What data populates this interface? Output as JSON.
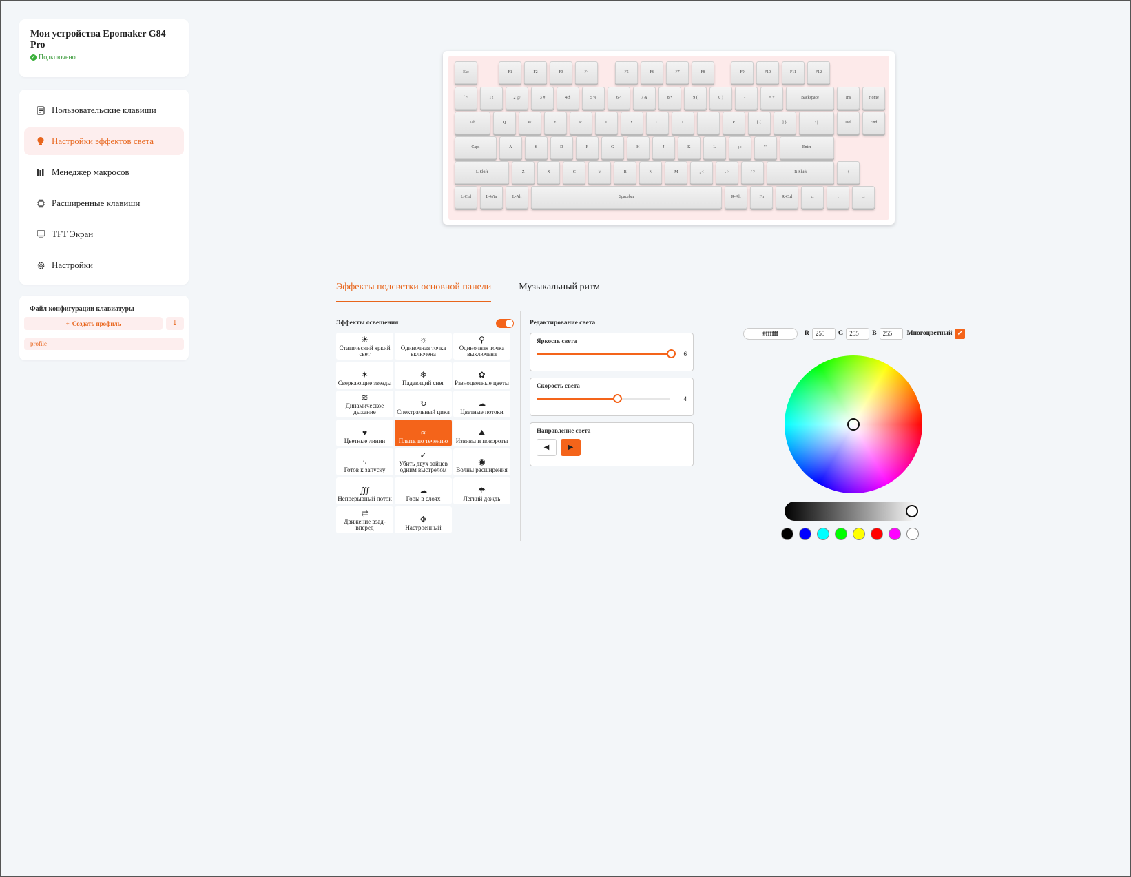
{
  "device": {
    "title": "Мои устройства Epomaker G84 Pro",
    "status": "Подключено"
  },
  "nav": {
    "items": [
      {
        "label": "Пользовательские клавиши",
        "icon": "custom-keys-icon"
      },
      {
        "label": "Настройки эффектов света",
        "icon": "light-bulb-icon"
      },
      {
        "label": "Менеджер макросов",
        "icon": "macro-icon"
      },
      {
        "label": "Расширенные клавиши",
        "icon": "chip-icon"
      },
      {
        "label": "TFT Экран",
        "icon": "monitor-icon"
      },
      {
        "label": "Настройки",
        "icon": "gear-icon"
      }
    ],
    "active_index": 1
  },
  "profile": {
    "label": "Файл конфигурации клавиатуры",
    "create_label": "Создать профиль",
    "items": [
      "profile"
    ]
  },
  "keyboard": {
    "rows": [
      [
        "Esc",
        "F1",
        "F2",
        "F3",
        "F4",
        "F5",
        "F6",
        "F7",
        "F8",
        "F9",
        "F10",
        "F11",
        "F12"
      ],
      [
        "` ~",
        "1 !",
        "2 @",
        "3 #",
        "4 $",
        "5 %",
        "6 ^",
        "7 &",
        "8 *",
        "9 (",
        "0 )",
        "- _",
        "= +",
        "Backspace",
        "Ins",
        "Home"
      ],
      [
        "Tab",
        "Q",
        "W",
        "E",
        "R",
        "T",
        "Y",
        "U",
        "I",
        "O",
        "P",
        "[ {",
        "] }",
        "\\ |",
        "Del",
        "End"
      ],
      [
        "Caps",
        "A",
        "S",
        "D",
        "F",
        "G",
        "H",
        "J",
        "K",
        "L",
        "; :",
        "' \"",
        "Enter"
      ],
      [
        "L-Shift",
        "Z",
        "X",
        "C",
        "V",
        "B",
        "N",
        "M",
        ", <",
        ". >",
        "/ ?",
        "R-Shift",
        "↑"
      ],
      [
        "L-Ctrl",
        "L-Win",
        "L-Alt",
        "Spacebar",
        "R-Alt",
        "Fn",
        "R-Ctrl",
        "←",
        "↓",
        "→"
      ]
    ]
  },
  "tabs": [
    {
      "label": "Эффекты подсветки основной панели",
      "active": true
    },
    {
      "label": "Музыкальный ритм",
      "active": false
    }
  ],
  "effects": {
    "title": "Эффекты освещения",
    "enabled": true,
    "items": [
      {
        "label": "Статический яркий свет",
        "icon": "sun-icon"
      },
      {
        "label": "Одиночная точка включена",
        "icon": "sun-outline-icon"
      },
      {
        "label": "Одиночная точка выключена",
        "icon": "bulb-icon"
      },
      {
        "label": "Сверкающие звезды",
        "icon": "stars-icon"
      },
      {
        "label": "Падающий снег",
        "icon": "snow-icon"
      },
      {
        "label": "Разноцветные цветы",
        "icon": "flower-icon"
      },
      {
        "label": "Динамическое дыхание",
        "icon": "wind-icon"
      },
      {
        "label": "Спектральный цикл",
        "icon": "cycle-icon"
      },
      {
        "label": "Цветные потоки",
        "icon": "flow-icon"
      },
      {
        "label": "Цветные линии",
        "icon": "lines-icon"
      },
      {
        "label": "Плыть по течению",
        "icon": "waves-icon"
      },
      {
        "label": "Извивы и повороты",
        "icon": "mountain-icon"
      },
      {
        "label": "Готов к запуску",
        "icon": "lightning-icon"
      },
      {
        "label": "Убить двух зайцев одним выстрелом",
        "icon": "check-double-icon"
      },
      {
        "label": "Волны расширения",
        "icon": "broadcast-icon"
      },
      {
        "label": "Непрерывный поток",
        "icon": "stream-icon"
      },
      {
        "label": "Горы в слоях",
        "icon": "layers-icon"
      },
      {
        "label": "Легкий дождь",
        "icon": "rain-icon"
      },
      {
        "label": "Движение взад-вперед",
        "icon": "swap-icon"
      },
      {
        "label": "Настроенный",
        "icon": "custom-icon"
      }
    ],
    "active_index": 10
  },
  "edit": {
    "title": "Редактирование света",
    "brightness_label": "Яркость света",
    "brightness_value": "6",
    "brightness_fraction": 1.0,
    "speed_label": "Скорость света",
    "speed_value": "4",
    "speed_fraction": 0.6,
    "direction_label": "Направление света",
    "direction_active": "right"
  },
  "color": {
    "hex": "#ffffff",
    "r_label": "R",
    "r": "255",
    "g_label": "G",
    "g": "255",
    "b_label": "B",
    "b": "255",
    "multicolor_label": "Многоцветный",
    "multicolor": true,
    "swatches": [
      "#000000",
      "#0000ff",
      "#00ffff",
      "#00ff00",
      "#ffff00",
      "#ff0000",
      "#ff00ff",
      "#ffffff"
    ]
  },
  "accent_color": "#f4641a"
}
